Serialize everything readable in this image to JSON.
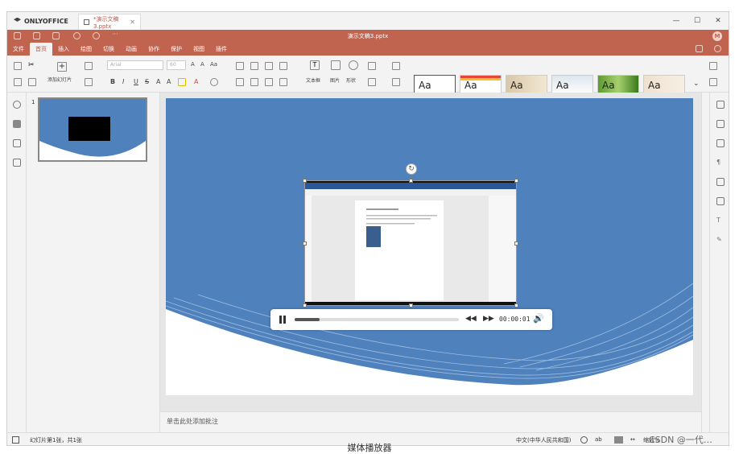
{
  "app": {
    "brand": "ONLYOFFICE",
    "tab_title": "*演示文稿3.pptx",
    "doc_title": "演示文稿3.pptx",
    "avatar": "M",
    "window_controls": [
      "—",
      "☐",
      "✕"
    ]
  },
  "menu": {
    "items": [
      "文件",
      "首页",
      "插入",
      "绘图",
      "切换",
      "动画",
      "协作",
      "保护",
      "视图",
      "插件"
    ],
    "active_index": 1
  },
  "toolbar": {
    "add_slide": "添加幻灯片",
    "font_name": "Arial",
    "font_size": "60",
    "text_box": "文本框",
    "image": "图片",
    "shape": "形状",
    "themes": [
      "Aa",
      "Aa",
      "Aa",
      "Aa",
      "Aa",
      "Aa"
    ]
  },
  "thumbnails": {
    "slide_number": "1"
  },
  "player": {
    "time": "00:00:01",
    "progress_fraction": 0.15
  },
  "notes": {
    "placeholder": "单击此处添加批注"
  },
  "status": {
    "slide_info": "幻灯片第1张，共1张",
    "language": "中文(中华人民共和国)",
    "zoom": "缩放%"
  },
  "caption": "媒体播放器",
  "watermark": "CSDN @一代…",
  "colors": {
    "accent": "#c0644f",
    "slide_blue": "#4f81bd"
  }
}
